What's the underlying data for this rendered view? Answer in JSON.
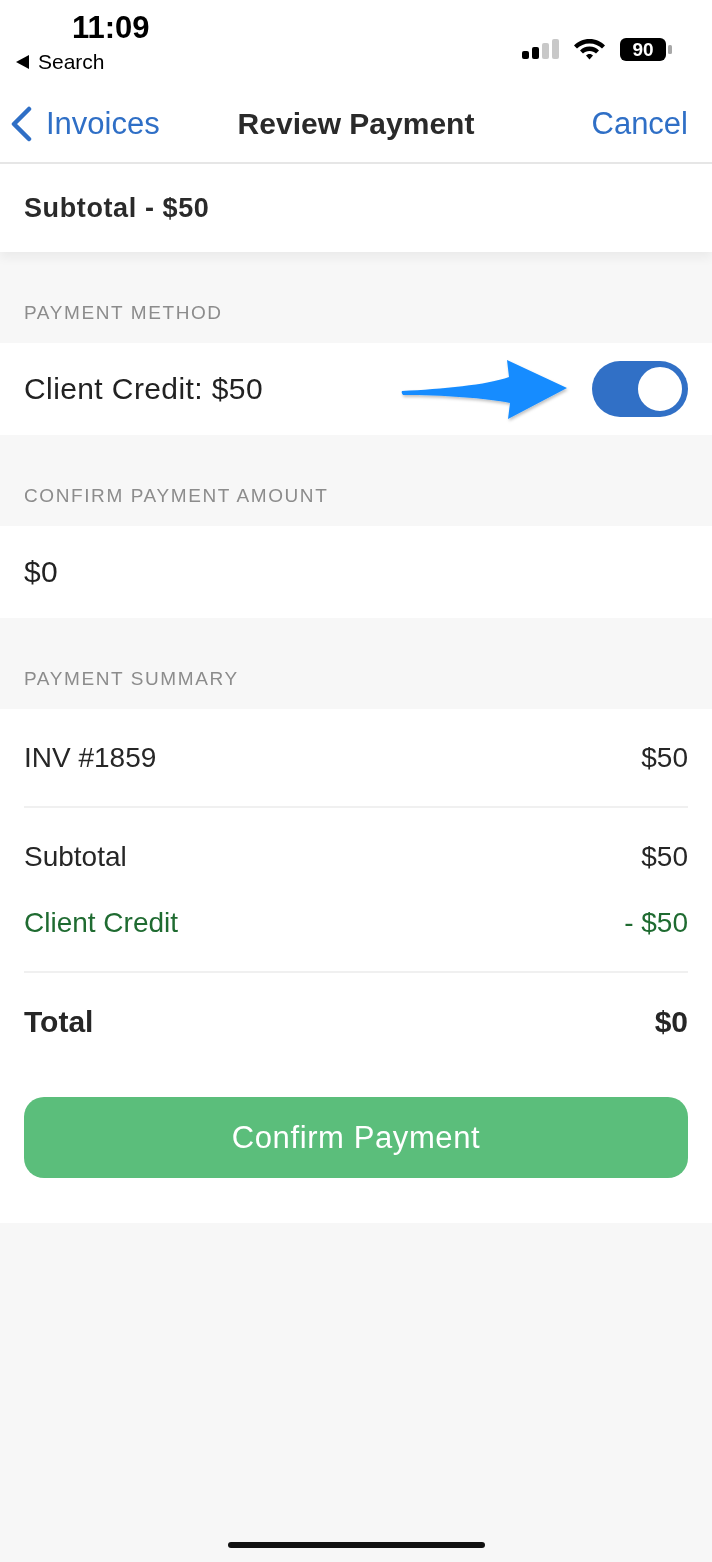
{
  "status_bar": {
    "time": "11:09",
    "back_label": "Search",
    "battery": "90"
  },
  "nav": {
    "back": "Invoices",
    "title": "Review Payment",
    "action": "Cancel"
  },
  "subtotal_banner": "Subtotal - $50",
  "sections": [
    {
      "kind": "toggle",
      "header": "PAYMENT METHOD",
      "label": "Client Credit: $50",
      "on": true
    },
    {
      "kind": "amount",
      "header": "CONFIRM PAYMENT AMOUNT",
      "value": "$0"
    },
    {
      "kind": "summary",
      "header": "PAYMENT SUMMARY",
      "groups": [
        [
          {
            "kind": "item",
            "label": "INV #1859",
            "amount": "$50"
          }
        ],
        [
          {
            "kind": "item",
            "label": "Subtotal",
            "amount": "$50"
          },
          {
            "kind": "credit",
            "label": "Client Credit",
            "amount": "- $50"
          }
        ],
        [
          {
            "kind": "total",
            "label": "Total",
            "amount": "$0"
          }
        ]
      ],
      "button": "Confirm Payment"
    }
  ]
}
